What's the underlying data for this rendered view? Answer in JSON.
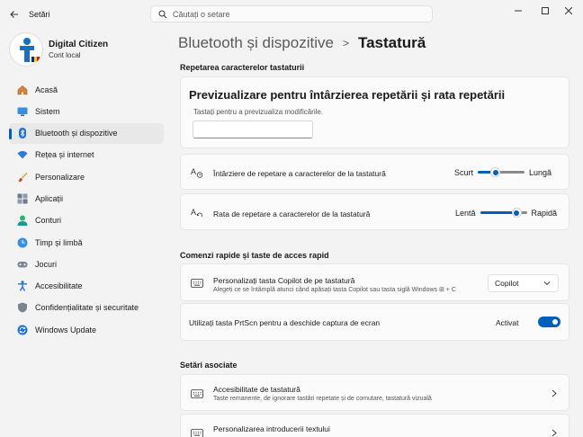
{
  "window": {
    "title": "Setări"
  },
  "search": {
    "placeholder": "Căutați o setare"
  },
  "user": {
    "name": "Digital Citizen",
    "account": "Cont local"
  },
  "sidebar": {
    "items": [
      {
        "label": "Acasă",
        "icon": "home-icon"
      },
      {
        "label": "Sistem",
        "icon": "monitor-icon"
      },
      {
        "label": "Bluetooth și dispozitive",
        "icon": "bluetooth-icon",
        "active": true
      },
      {
        "label": "Rețea și internet",
        "icon": "wifi-icon"
      },
      {
        "label": "Personalizare",
        "icon": "brush-icon"
      },
      {
        "label": "Aplicații",
        "icon": "apps-icon"
      },
      {
        "label": "Conturi",
        "icon": "person-icon"
      },
      {
        "label": "Timp și limbă",
        "icon": "globe-clock-icon"
      },
      {
        "label": "Jocuri",
        "icon": "gamepad-icon"
      },
      {
        "label": "Accesibilitate",
        "icon": "accessibility-icon"
      },
      {
        "label": "Confidențialitate și securitate",
        "icon": "shield-icon"
      },
      {
        "label": "Windows Update",
        "icon": "update-icon"
      }
    ]
  },
  "breadcrumb": {
    "parent": "Bluetooth și dispozitive",
    "separator": ">",
    "current": "Tastatură"
  },
  "repeat_section": {
    "heading": "Repetarea caracterelor tastaturii",
    "preview_title": "Previzualizare pentru întârzierea repetării și rata repetării",
    "preview_hint": "Tastați pentru a previzualiza modificările.",
    "preview_value": "",
    "delay": {
      "label": "Întârziere de repetare a caracterelor de la tastatură",
      "min_label": "Scurt",
      "max_label": "Lungă",
      "level": 0.35
    },
    "rate": {
      "label": "Rata de repetare a caracterelor de la tastatură",
      "min_label": "Lentă",
      "max_label": "Rapidă",
      "level": 0.85
    }
  },
  "shortcuts_section": {
    "heading": "Comenzi rapide și taste de acces rapid",
    "copilot": {
      "label": "Personalizați tasta Copilot de pe tastatură",
      "sub": "Alegeți ce se întâmplă atunci când apăsați tasta Copilot sau tasta siglă Windows ⊞ + C",
      "value": "Copilot"
    },
    "prtscn": {
      "label": "Utilizați tasta PrtScn pentru a deschide captura de ecran",
      "state": "Activat",
      "on": true
    }
  },
  "related_section": {
    "heading": "Setări asociate",
    "accessibility": {
      "label": "Accesibilitate de tastatură",
      "sub": "Taste remanente, de ignorare tastări repetate și de comutare, tastatură vizuală"
    },
    "typing": {
      "label": "Personalizarea introducerii textului"
    }
  },
  "colors": {
    "accent": "#005fb8",
    "background": "#f3f3f3",
    "card": "#fbfbfb"
  }
}
